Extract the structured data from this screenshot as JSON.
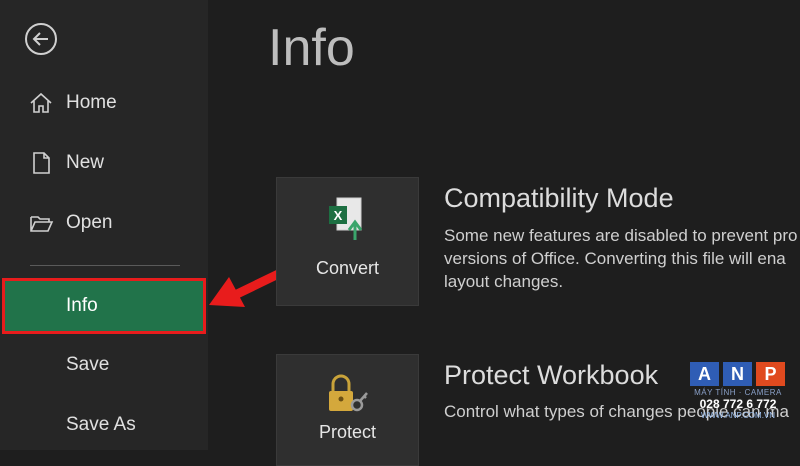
{
  "sidebar": {
    "items": [
      {
        "label": "Home",
        "icon": "home-icon"
      },
      {
        "label": "New",
        "icon": "new-document-icon"
      },
      {
        "label": "Open",
        "icon": "open-folder-icon"
      },
      {
        "label": "Info"
      },
      {
        "label": "Save"
      },
      {
        "label": "Save As"
      }
    ],
    "active_color": "#21734a",
    "highlight_color": "#e81c1c"
  },
  "main": {
    "title": "Info",
    "sections": [
      {
        "tile_label": "Convert",
        "title": "Compatibility Mode",
        "desc_lines": [
          "Some new features are disabled to prevent pro",
          "versions of Office. Converting this file will ena",
          "layout changes."
        ]
      },
      {
        "tile_label": "Protect",
        "title": "Protect Workbook",
        "desc_lines": [
          "Control what types of changes people can ma"
        ]
      }
    ]
  },
  "watermark": {
    "letters": [
      "A",
      "N",
      "P"
    ],
    "tagline": "MÁY TÍNH · CAMERA",
    "phone": "028 772 6 772",
    "site": "WWW.ANP.COM.VN"
  }
}
